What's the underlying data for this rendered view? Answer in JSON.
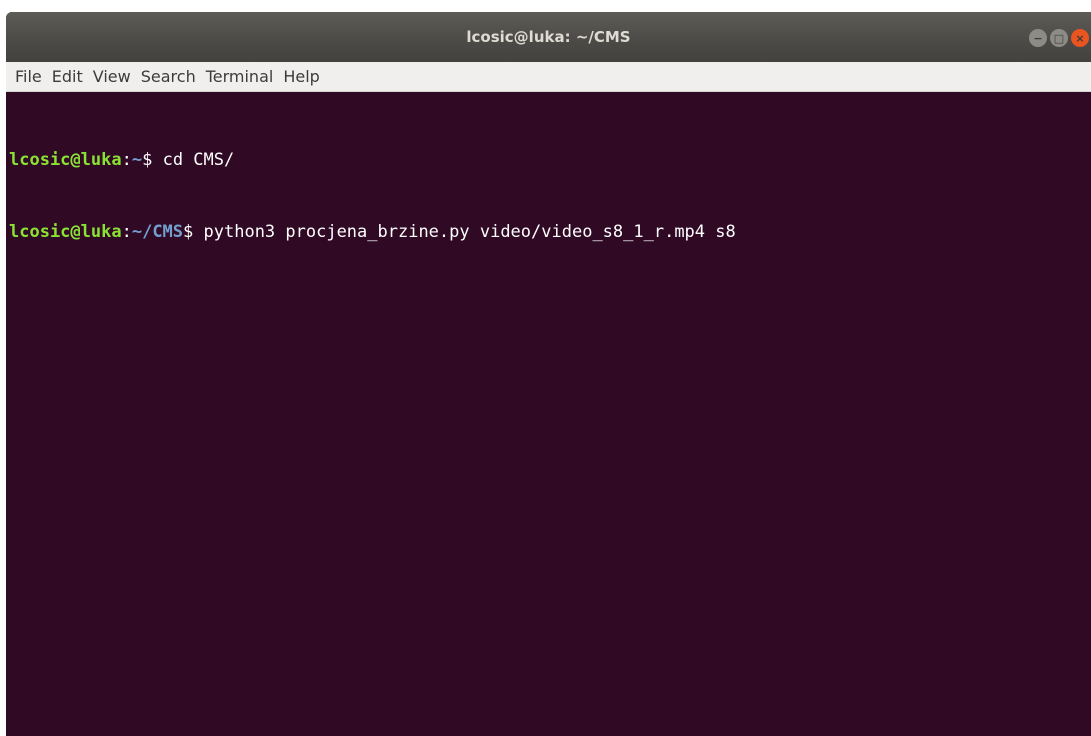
{
  "window": {
    "title": "lcosic@luka: ~/CMS",
    "controls": {
      "minimize_icon": "−",
      "maximize_icon": "□",
      "close_icon": "×"
    }
  },
  "menubar": {
    "items": [
      "File",
      "Edit",
      "View",
      "Search",
      "Terminal",
      "Help"
    ]
  },
  "terminal": {
    "lines": [
      {
        "user": "lcosic@luka",
        "colon": ":",
        "path": "~",
        "prompt": "$",
        "command": " cd CMS/"
      },
      {
        "user": "lcosic@luka",
        "colon": ":",
        "path": "~/CMS",
        "prompt": "$",
        "command": " python3 procjena_brzine.py video/video_s8_1_r.mp4 s8"
      }
    ]
  },
  "colors": {
    "terminal_bg": "#300a24",
    "prompt_user": "#8ae234",
    "prompt_path": "#729fcf",
    "close_button": "#e95420"
  }
}
